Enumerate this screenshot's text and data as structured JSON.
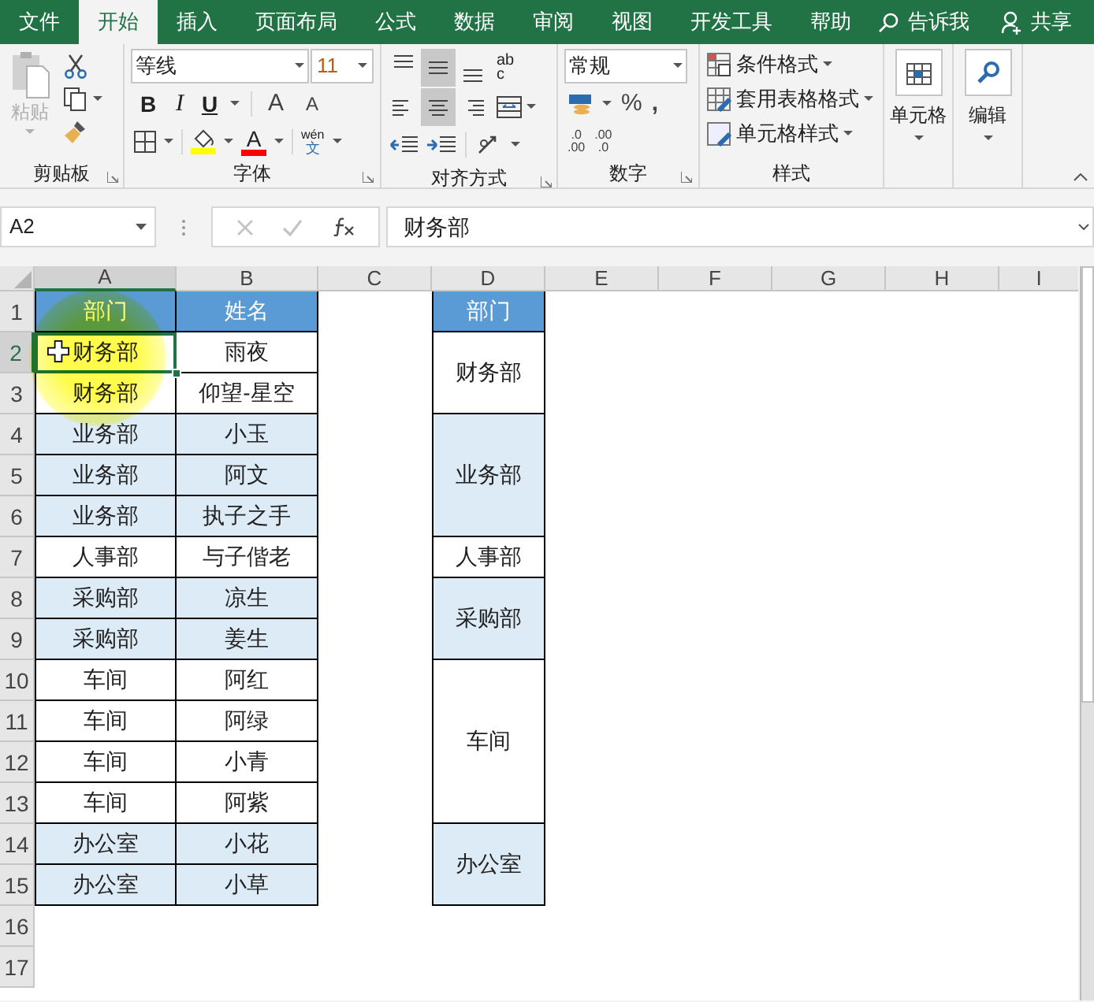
{
  "tabs": [
    {
      "label": "文件",
      "selected": false
    },
    {
      "label": "开始",
      "selected": true
    },
    {
      "label": "插入",
      "selected": false
    },
    {
      "label": "页面布局",
      "selected": false
    },
    {
      "label": "公式",
      "selected": false
    },
    {
      "label": "数据",
      "selected": false
    },
    {
      "label": "审阅",
      "selected": false
    },
    {
      "label": "视图",
      "selected": false
    },
    {
      "label": "开发工具",
      "selected": false
    },
    {
      "label": "帮助",
      "selected": false
    }
  ],
  "tell_me": "告诉我",
  "share": "共享",
  "ribbon": {
    "clipboard": {
      "label": "剪贴板",
      "paste": {
        "label": "粘贴",
        "disabled": true
      }
    },
    "font": {
      "label": "字体",
      "font_name": "等线",
      "font_size": "11",
      "bold": "B",
      "italic": "I",
      "underline": "U",
      "grow": "A",
      "shrink": "A",
      "font_color_letter": "A",
      "phonetic_top": "wén",
      "phonetic_bottom": "文"
    },
    "alignment": {
      "label": "对齐方式",
      "wrap_top": "ab",
      "wrap_bottom": "c",
      "vertical": [
        {
          "selected": false
        },
        {
          "selected": true
        },
        {
          "selected": false
        }
      ],
      "horizontal": [
        {
          "selected": false
        },
        {
          "selected": true
        },
        {
          "selected": false
        }
      ]
    },
    "number": {
      "label": "数字",
      "format": "常规",
      "percent": "%",
      "comma": ",",
      "dec_inc_top": ".0",
      "dec_inc_bottom": ".00",
      "dec_dec_top": ".00",
      "dec_dec_bottom": ".0"
    },
    "styles": {
      "label": "样式",
      "items": [
        "条件格式",
        "套用表格格式",
        "单元格样式"
      ]
    },
    "cells": {
      "label": "单元格"
    },
    "editing": {
      "label": "编辑"
    }
  },
  "name_box": "A2",
  "formula": "财务部",
  "column_headers": [
    {
      "label": "A",
      "selected": true
    },
    {
      "label": "B",
      "selected": false
    },
    {
      "label": "C",
      "selected": false
    },
    {
      "label": "D",
      "selected": false
    },
    {
      "label": "E",
      "selected": false
    },
    {
      "label": "F",
      "selected": false
    },
    {
      "label": "G",
      "selected": false
    },
    {
      "label": "H",
      "selected": false
    },
    {
      "label": "I",
      "selected": false
    }
  ],
  "row_headers": [
    {
      "label": "1",
      "selected": false
    },
    {
      "label": "2",
      "selected": true
    },
    {
      "label": "3",
      "selected": false
    },
    {
      "label": "4",
      "selected": false
    },
    {
      "label": "5",
      "selected": false
    },
    {
      "label": "6",
      "selected": false
    },
    {
      "label": "7",
      "selected": false
    },
    {
      "label": "8",
      "selected": false
    },
    {
      "label": "9",
      "selected": false
    },
    {
      "label": "10",
      "selected": false
    },
    {
      "label": "11",
      "selected": false
    },
    {
      "label": "12",
      "selected": false
    },
    {
      "label": "13",
      "selected": false
    },
    {
      "label": "14",
      "selected": false
    },
    {
      "label": "15",
      "selected": false
    },
    {
      "label": "16",
      "selected": false
    },
    {
      "label": "17",
      "selected": false
    }
  ],
  "table": {
    "columns": [
      "部门",
      "姓名"
    ],
    "summary_header": "部门",
    "groups": [
      {
        "summary": "财务部",
        "shaded": false,
        "rows": [
          {
            "department": "财务部",
            "name": "雨夜",
            "selected": true
          },
          {
            "department": "财务部",
            "name": "仰望-星空",
            "selected": false
          }
        ]
      },
      {
        "summary": "业务部",
        "shaded": true,
        "rows": [
          {
            "department": "业务部",
            "name": "小玉",
            "selected": false
          },
          {
            "department": "业务部",
            "name": "阿文",
            "selected": false
          },
          {
            "department": "业务部",
            "name": "执子之手",
            "selected": false
          }
        ]
      },
      {
        "summary": "人事部",
        "shaded": false,
        "rows": [
          {
            "department": "人事部",
            "name": "与子偕老",
            "selected": false
          }
        ]
      },
      {
        "summary": "采购部",
        "shaded": true,
        "rows": [
          {
            "department": "采购部",
            "name": "凉生",
            "selected": false
          },
          {
            "department": "采购部",
            "name": "姜生",
            "selected": false
          }
        ]
      },
      {
        "summary": "车间",
        "shaded": false,
        "rows": [
          {
            "department": "车间",
            "name": "阿红",
            "selected": false
          },
          {
            "department": "车间",
            "name": "阿绿",
            "selected": false
          },
          {
            "department": "车间",
            "name": "小青",
            "selected": false
          },
          {
            "department": "车间",
            "name": "阿紫",
            "selected": false
          }
        ]
      },
      {
        "summary": "办公室",
        "shaded": true,
        "rows": [
          {
            "department": "办公室",
            "name": "小花",
            "selected": false
          },
          {
            "department": "办公室",
            "name": "小草",
            "selected": false
          }
        ]
      }
    ]
  }
}
